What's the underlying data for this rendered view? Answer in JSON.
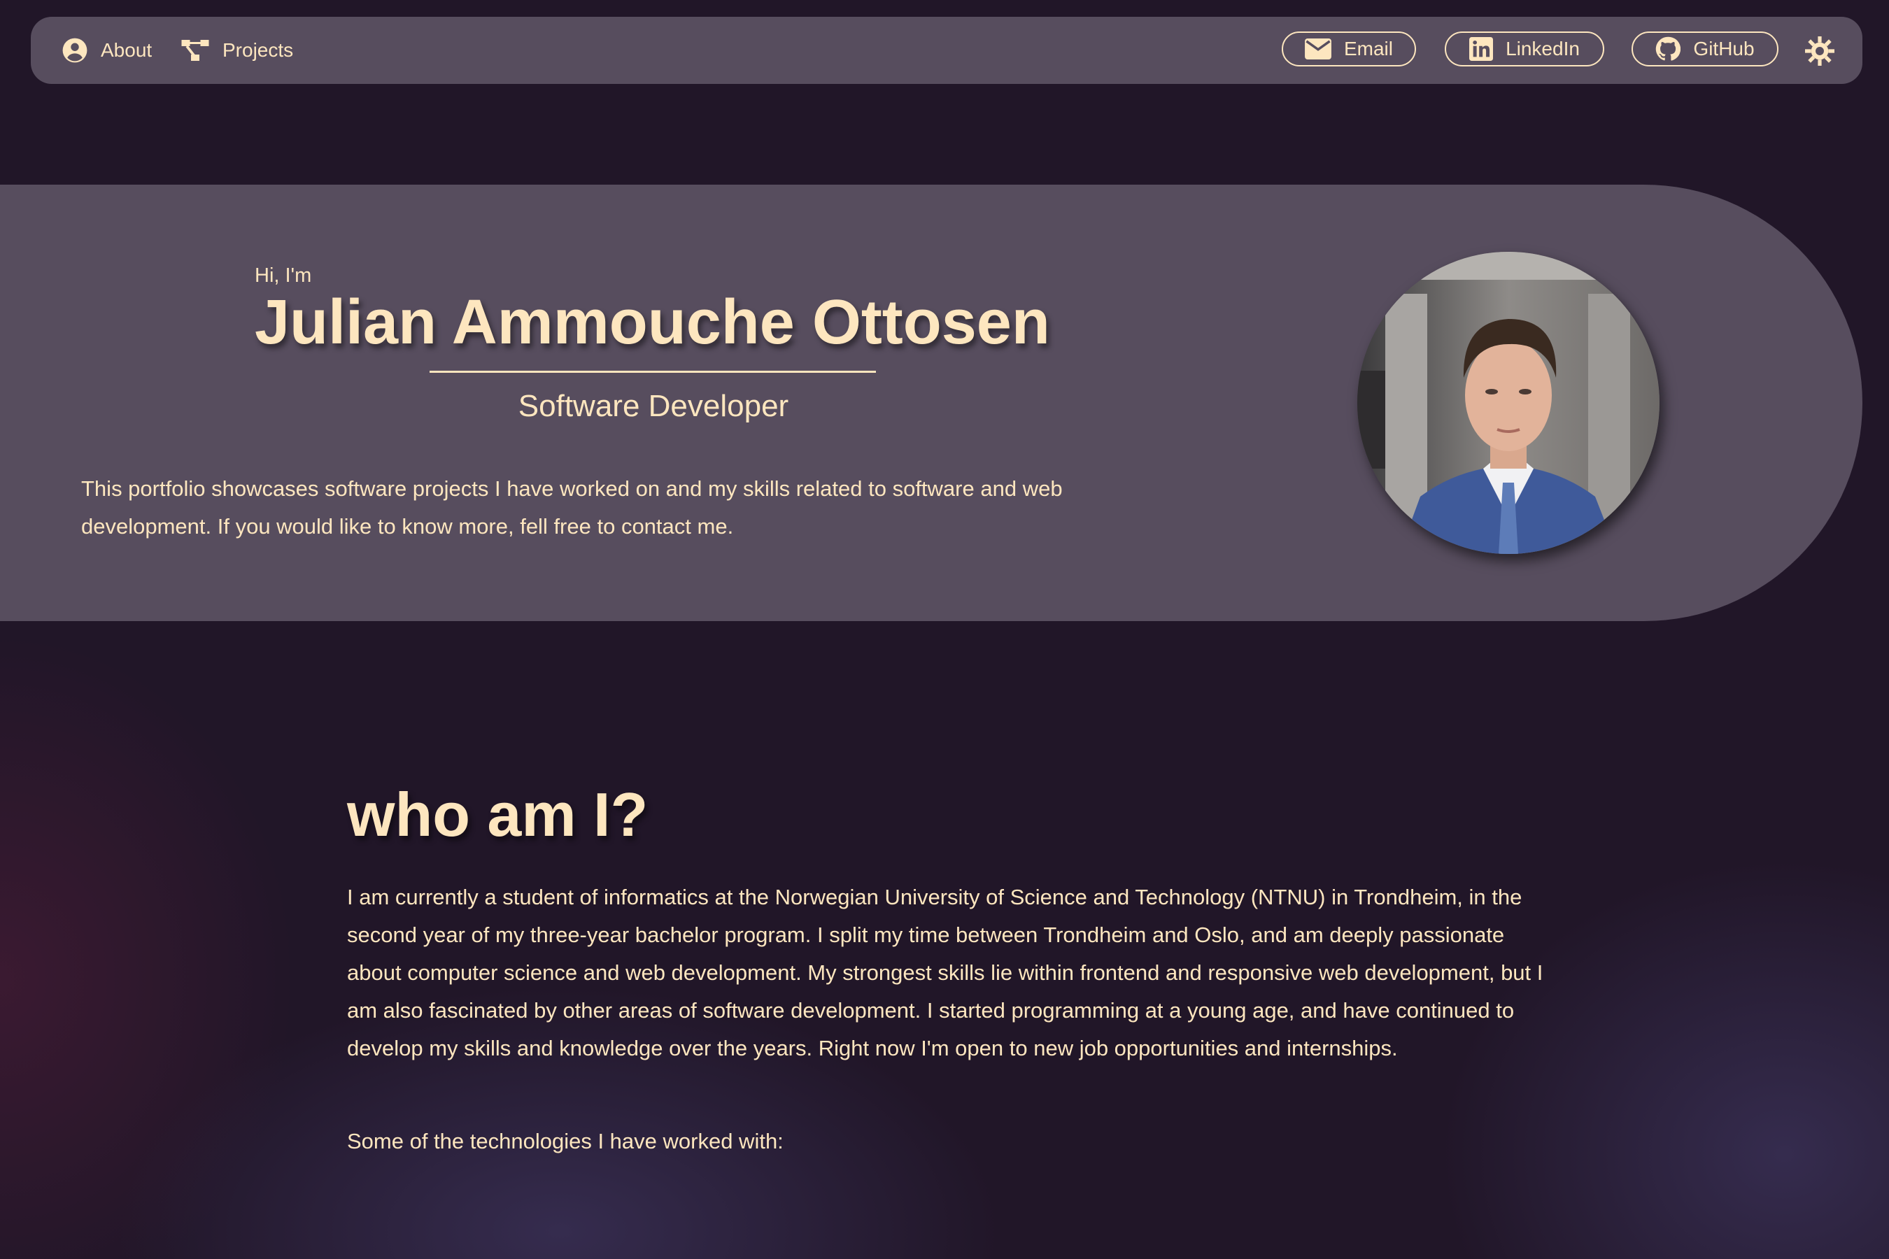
{
  "nav": {
    "about_label": "About",
    "projects_label": "Projects",
    "email_label": "Email",
    "linkedin_label": "LinkedIn",
    "github_label": "GitHub",
    "theme_icon": "sun-icon"
  },
  "hero": {
    "greeting": "Hi, I'm",
    "name": "Julian Ammouche Ottosen",
    "role": "Software Developer",
    "intro": "This portfolio showcases software projects I have worked on and my skills related to software and web development. If you would like to know more, fell free to contact me."
  },
  "about": {
    "heading": "who am I?",
    "body": "I am currently a student of informatics at the Norwegian University of Science and Technology (NTNU) in Trondheim, in the second year of my three-year bachelor program. I split my time between Trondheim and Oslo, and am deeply passionate about computer science and web development. My strongest skills lie within frontend and responsive web development, but I am also fascinated by other areas of software development. I started programming at a young age, and have continued to develop my skills and knowledge over the years. Right now I'm open to new job opportunities and internships.",
    "tech_intro": "Some of the technologies I have worked with:"
  },
  "colors": {
    "background": "#211628",
    "panel": "#574d5e",
    "text": "#fde6bf"
  }
}
